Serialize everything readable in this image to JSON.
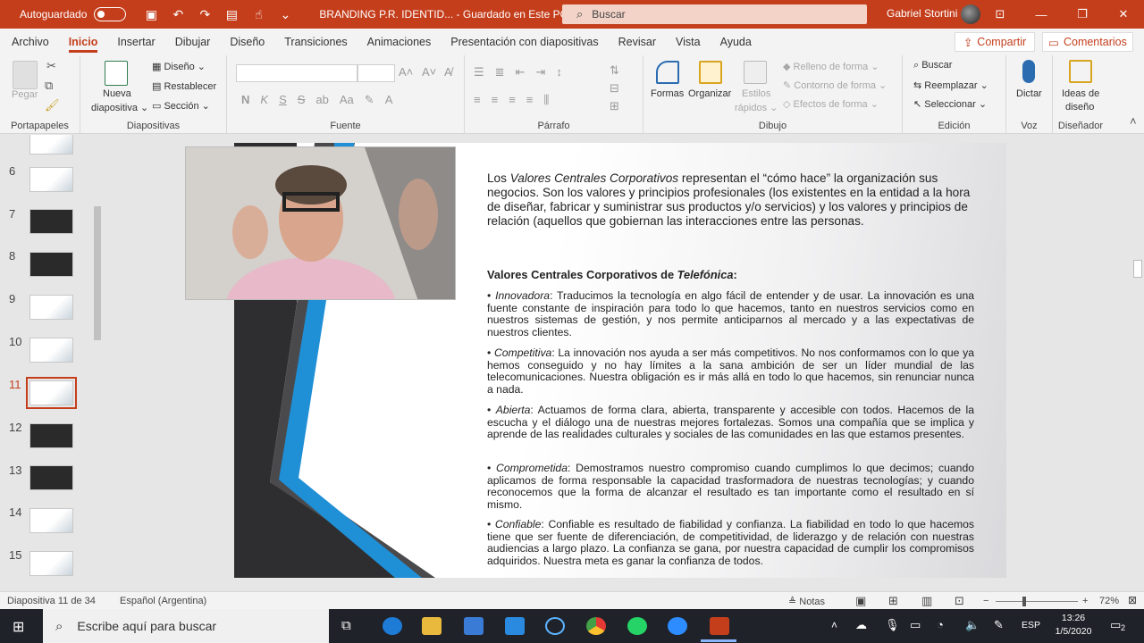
{
  "titlebar": {
    "autosave_label": "Autoguardado",
    "doc_title": "BRANDING P.R. IDENTID...  -  Guardado en Este PC  ⌄",
    "search_placeholder": "Buscar",
    "user_name": "Gabriel Stortini"
  },
  "tabs": [
    "Archivo",
    "Inicio",
    "Insertar",
    "Dibujar",
    "Diseño",
    "Transiciones",
    "Animaciones",
    "Presentación con diapositivas",
    "Revisar",
    "Vista",
    "Ayuda"
  ],
  "share_label": "Compartir",
  "comments_label": "Comentarios",
  "ribbon": {
    "portapapeles": {
      "label": "Portapapeles",
      "paste": "Pegar"
    },
    "diapositivas": {
      "label": "Diapositivas",
      "new_slide": "Nueva",
      "new_slide2": "diapositiva ⌄",
      "layout": "Diseño ⌄",
      "reset": "Restablecer",
      "section": "Sección ⌄"
    },
    "fuente": {
      "label": "Fuente",
      "bold": "N",
      "italic": "K",
      "underline": "S",
      "strike": "S"
    },
    "parrafo": {
      "label": "Párrafo"
    },
    "dibujo": {
      "label": "Dibujo",
      "shapes": "Formas",
      "arrange": "Organizar",
      "styles": "Estilos",
      "styles2": "rápidos ⌄",
      "fill": "Relleno de forma ⌄",
      "outline": "Contorno de forma ⌄",
      "effects": "Efectos de forma ⌄"
    },
    "edicion": {
      "label": "Edición",
      "find": "Buscar",
      "replace": "Reemplazar ⌄",
      "select": "Seleccionar ⌄"
    },
    "voz": {
      "label": "Voz",
      "dictate": "Dictar"
    },
    "disenador": {
      "label": "Diseñador",
      "ideas": "Ideas de",
      "ideas2": "diseño"
    }
  },
  "thumbnails": [
    {
      "num": "6",
      "style": "light"
    },
    {
      "num": "7",
      "style": "dark"
    },
    {
      "num": "8",
      "style": "dark"
    },
    {
      "num": "9",
      "style": "light"
    },
    {
      "num": "10",
      "style": "light"
    },
    {
      "num": "11",
      "style": "light",
      "selected": true
    },
    {
      "num": "12",
      "style": "dark"
    },
    {
      "num": "13",
      "style": "dark"
    },
    {
      "num": "14",
      "style": "light"
    },
    {
      "num": "15",
      "style": "light"
    }
  ],
  "slide": {
    "intro_a": "Los ",
    "intro_em": "Valores Centrales Corporativos",
    "intro_b": " representan el “cómo hace” la organización sus negocios. Son los valores y principios profesionales (los existentes en la entidad a la hora de diseñar, fabricar y suministrar sus productos y/o servicios) y los valores y principios de relación (aquellos que gobiernan las interacciones entre las personas.",
    "subtitle_a": "Valores Centrales Corporativos de ",
    "subtitle_em": "Telefónica",
    "subtitle_b": ":",
    "bullets": [
      {
        "term": "Innovadora",
        "text": ": Traducimos la tecnología en algo fácil de entender y de usar. La innovación es una fuente constante de inspiración para todo lo que hacemos, tanto en nuestros servicios como en nuestros sistemas de gestión, y nos permite anticiparnos al mercado y a las expectativas de nuestros clientes."
      },
      {
        "term": "Competitiva",
        "text": ": La innovación nos ayuda a ser más competitivos. No nos conformamos con lo que ya hemos conseguido y no hay límites a la sana ambición de ser un líder mundial de las telecomunicaciones. Nuestra obligación es ir más allá en todo lo que hacemos, sin renunciar nunca a nada."
      },
      {
        "term": "Abierta",
        "text": ": Actuamos de forma clara, abierta, transparente y accesible con todos. Hacemos de la escucha y el diálogo una de nuestras mejores fortalezas. Somos una compañía que se implica y aprende de las realidades culturales y sociales de las comunidades en las que estamos presentes."
      },
      {
        "term": "Comprometida",
        "text": ": Demostramos nuestro compromiso cuando cumplimos lo que decimos; cuando aplicamos de forma responsable la capacidad trasformadora de nuestras tecnologías; y cuando reconocemos que la forma de alcanzar el resultado es tan importante como el resultado en sí mismo."
      },
      {
        "term": "Confiable",
        "text": ": Confiable es resultado de fiabilidad y confianza. La fiabilidad en todo lo que hacemos tiene que ser fuente de diferenciación, de competitividad, de liderazgo y de relación con nuestras audiencias a largo plazo. La confianza se gana, por nuestra capacidad de cumplir los compromisos adquiridos. Nuestra meta es ganar la confianza de todos."
      }
    ]
  },
  "status": {
    "slide_info": "Diapositiva 11 de 34",
    "language": "Español (Argentina)",
    "notes": "Notas",
    "zoom": "72%"
  },
  "taskbar": {
    "search_placeholder": "Escribe aquí para buscar",
    "lang": "ESP",
    "time": "13:26",
    "date": "1/5/2020",
    "notif_count": "2"
  },
  "colors": {
    "accent": "#c43e1c",
    "slide_blue": "#1f8fd6"
  }
}
